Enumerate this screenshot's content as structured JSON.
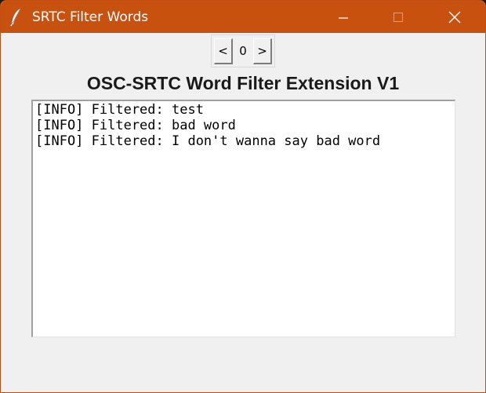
{
  "window": {
    "title": "SRTC Filter Words",
    "icon": "feather-icon",
    "controls": [
      "minimize-icon",
      "maximize-icon",
      "close-icon"
    ]
  },
  "stepper": {
    "prev_label": "<",
    "value": "0",
    "next_label": ">"
  },
  "heading": "OSC-SRTC Word Filter Extension V1",
  "log": {
    "lines": [
      "[INFO] Filtered: test",
      "[INFO] Filtered: bad word",
      "[INFO] Filtered: I don't wanna say bad word"
    ]
  },
  "colors": {
    "titlebar": "#c9510f",
    "window_bg": "#f0f0f0",
    "log_bg": "#ffffff"
  }
}
